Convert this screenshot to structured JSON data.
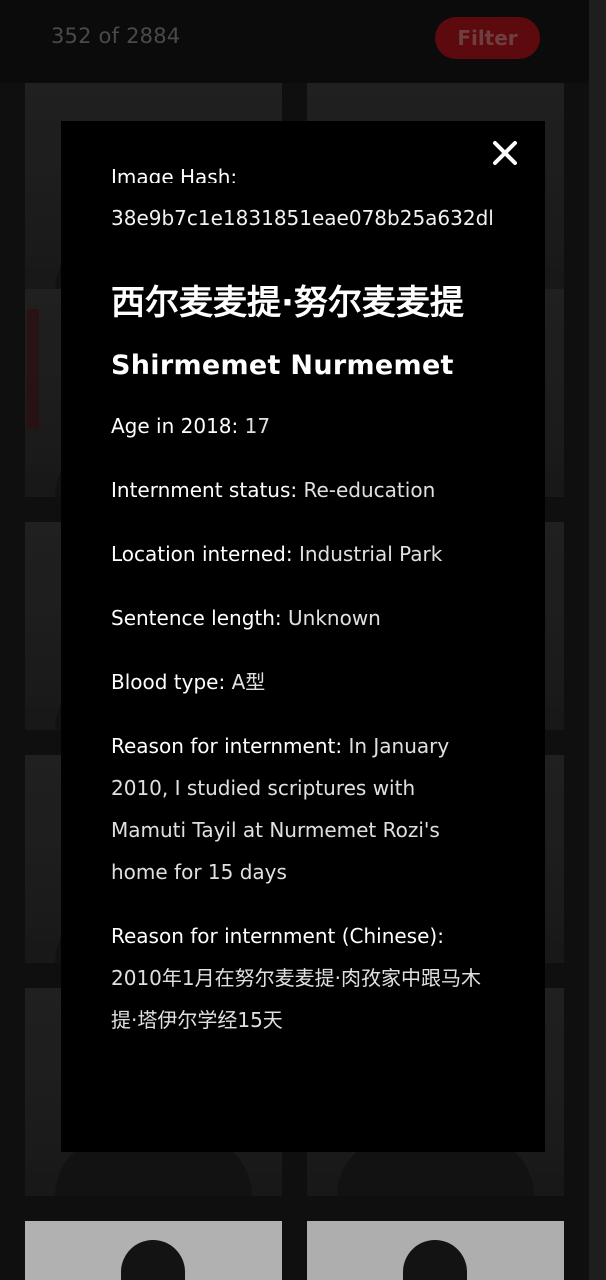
{
  "header": {
    "counter_text": "352 of 2884",
    "filter_label": "Filter"
  },
  "modal": {
    "image_hash_label": "Image Hash:",
    "image_hash_value": "38e9b7c1e1831851eae078b25a632dl",
    "name_chinese": "西尔麦麦提·努尔麦麦提",
    "name_english": "Shirmemet Nurmemet",
    "fields": [
      {
        "label": "Age in 2018:",
        "value": "17"
      },
      {
        "label": "Internment status:",
        "value": "Re-education"
      },
      {
        "label": "Location interned:",
        "value": "Industrial Park"
      },
      {
        "label": "Sentence length:",
        "value": "Unknown"
      },
      {
        "label": "Blood type:",
        "value": "A型"
      },
      {
        "label": "Reason for internment:",
        "value": "In January 2010, I studied scriptures with Mamuti Tayil at Nurmemet Rozi's home for 15 days"
      },
      {
        "label": "Reason for internment (Chinese):",
        "value": "2010年1月在努尔麦麦提·肉孜家中跟马木提·塔伊尔学经15天"
      }
    ]
  },
  "icons": {
    "close": "close-icon"
  },
  "colors": {
    "accent": "#c4161c",
    "modal_bg": "#000000",
    "page_bg": "#141414"
  }
}
